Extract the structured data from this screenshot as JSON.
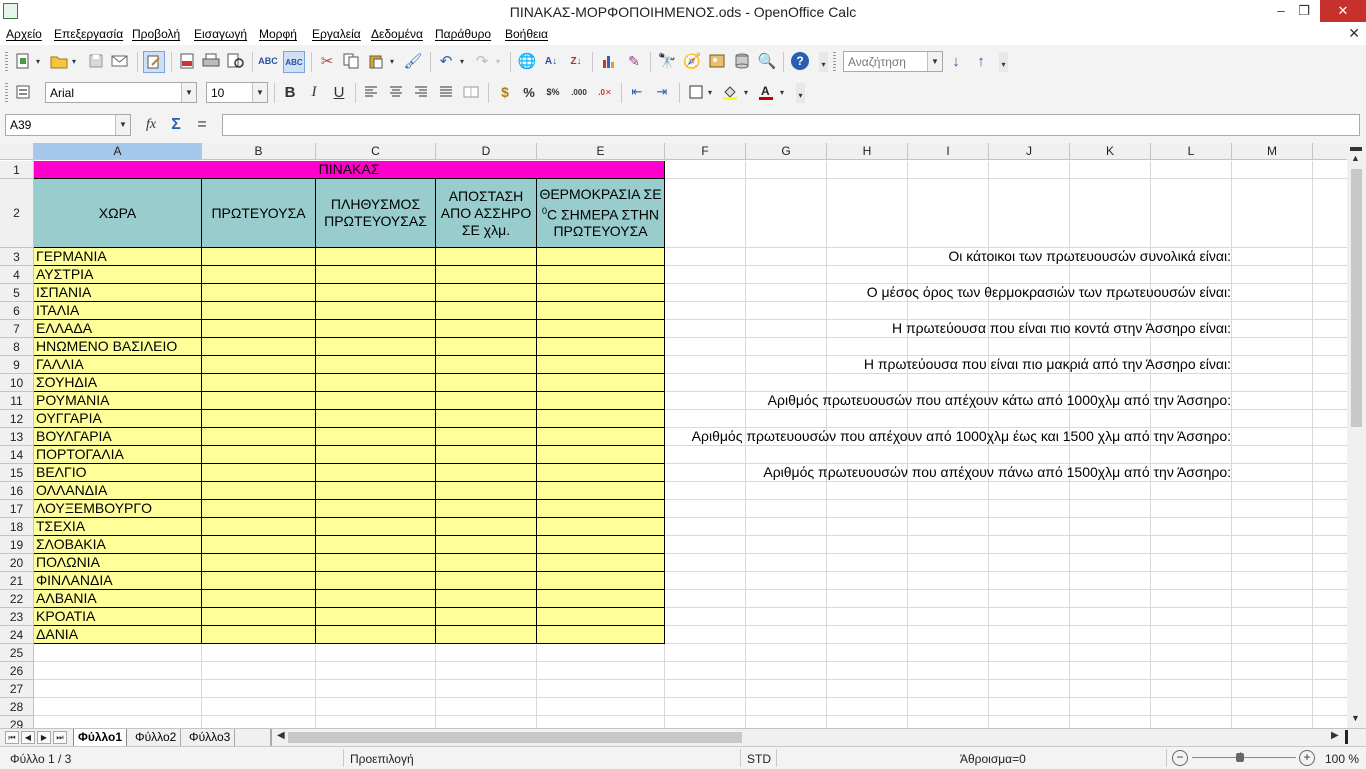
{
  "window": {
    "title": "ΠΙΝΑΚΑΣ-ΜΟΡΦΟΠΟΙΗΜΕΝΟΣ.ods - OpenOffice Calc",
    "min": "–",
    "max": "❐",
    "close": "✕",
    "doc_close": "✕"
  },
  "menu": [
    "Αρχείο",
    "Επεξεργασία",
    "Προβολή",
    "Εισαγωγή",
    "Μορφή",
    "Εργαλεία",
    "Δεδομένα",
    "Παράθυρο",
    "Βοήθεια"
  ],
  "toolbar": {
    "search_placeholder": "Αναζήτηση",
    "font_name": "Arial",
    "font_size": "10",
    "bold": "B",
    "italic": "I",
    "underline": "U"
  },
  "formula_bar": {
    "name_box": "A39",
    "formula": ""
  },
  "columns": [
    "A",
    "B",
    "C",
    "D",
    "E",
    "F",
    "G",
    "H",
    "I",
    "J",
    "K",
    "L",
    "M"
  ],
  "selected_column": "A",
  "rows": [
    "1",
    "2",
    "3",
    "4",
    "5",
    "6",
    "7",
    "8",
    "9",
    "10",
    "11",
    "12",
    "13",
    "14",
    "15",
    "16",
    "17",
    "18",
    "19",
    "20",
    "21",
    "22",
    "23",
    "24",
    "25",
    "26",
    "27",
    "28",
    "29"
  ],
  "sheet": {
    "title": "ΠΙΝΑΚΑΣ",
    "headers": {
      "a": "ΧΩΡΑ",
      "b": "ΠΡΩΤΕΥΟΥΣΑ",
      "c": "ΠΛΗΘΥΣΜΟΣ ΠΡΩΤΕΥΟΥΣΑΣ",
      "d": "ΑΠΟΣΤΑΣΗ ΑΠΟ ΑΣΣΗΡΟ ΣΕ χλμ.",
      "e_pre": "ΘΕΡΜΟΚΡΑΣΙΑ ΣΕ ",
      "e_sup": "0",
      "e_post": "C ΣΗΜΕΡΑ ΣΤΗΝ ΠΡΩΤΕΥΟΥΣΑ"
    },
    "countries": [
      "ΓΕΡΜΑΝΙΑ",
      "ΑΥΣΤΡΙΑ",
      "ΙΣΠΑΝΙΑ",
      "ΙΤΑΛΙΑ",
      "ΕΛΛΑΔΑ",
      "ΗΝΩΜΕΝΟ ΒΑΣΙΛΕΙΟ",
      "ΓΑΛΛΙΑ",
      "ΣΟΥΗΔΙΑ",
      "ΡΟΥΜΑΝΙΑ",
      "ΟΥΓΓΑΡΙΑ",
      "ΒΟΥΛΓΑΡΙΑ",
      "ΠΟΡΤΟΓΑΛΙΑ",
      "ΒΕΛΓΙΟ",
      "ΟΛΛΑΝΔΙΑ",
      "ΛΟΥΞΕΜΒΟΥΡΓΟ",
      "ΤΣΕΧΙΑ",
      "ΣΛΟΒΑΚΙΑ",
      "ΠΟΛΩΝΙΑ",
      "ΦΙΝΛΑΝΔΙΑ",
      "ΑΛΒΑΝΙΑ",
      "ΚΡΟΑΤΙΑ",
      "ΔΑΝΙΑ"
    ],
    "notes": [
      {
        "row": 3,
        "text": "Οι κάτοικοι των πρωτευουσών συνολικά είναι:"
      },
      {
        "row": 5,
        "text": "Ο μέσος όρος των θερμοκρασιών των πρωτευουσών είναι:"
      },
      {
        "row": 7,
        "text": "Η πρωτεύουσα που είναι πιο κοντά στην Άσσηρο είναι:"
      },
      {
        "row": 9,
        "text": "Η πρωτεύουσα που είναι πιο μακριά από την Άσσηρο είναι:"
      },
      {
        "row": 11,
        "text": "Αριθμός πρωτευουσών που απέχουν κάτω από 1000χλμ από την Άσσηρο:"
      },
      {
        "row": 13,
        "text": "Αριθμός πρωτευουσών που απέχουν από 1000χλμ  έως και 1500 χλμ από την Άσσηρο:"
      },
      {
        "row": 15,
        "text": "Αριθμός πρωτευουσών που απέχουν πάνω από 1500χλμ από την Άσσηρο:"
      }
    ]
  },
  "sheet_tabs": [
    "Φύλλο1",
    "Φύλλο2",
    "Φύλλο3"
  ],
  "active_tab": "Φύλλο1",
  "status": {
    "sheet": "Φύλλο 1 / 3",
    "style": "Προεπιλογή",
    "mode": "STD",
    "sum": "Άθροισμα=0",
    "zoom": "100 %"
  },
  "colors": {
    "title_fill": "#ff00cc",
    "header_fill": "#99cccc",
    "body_fill": "#ffff99",
    "selected_header": "#a6c7ec"
  }
}
